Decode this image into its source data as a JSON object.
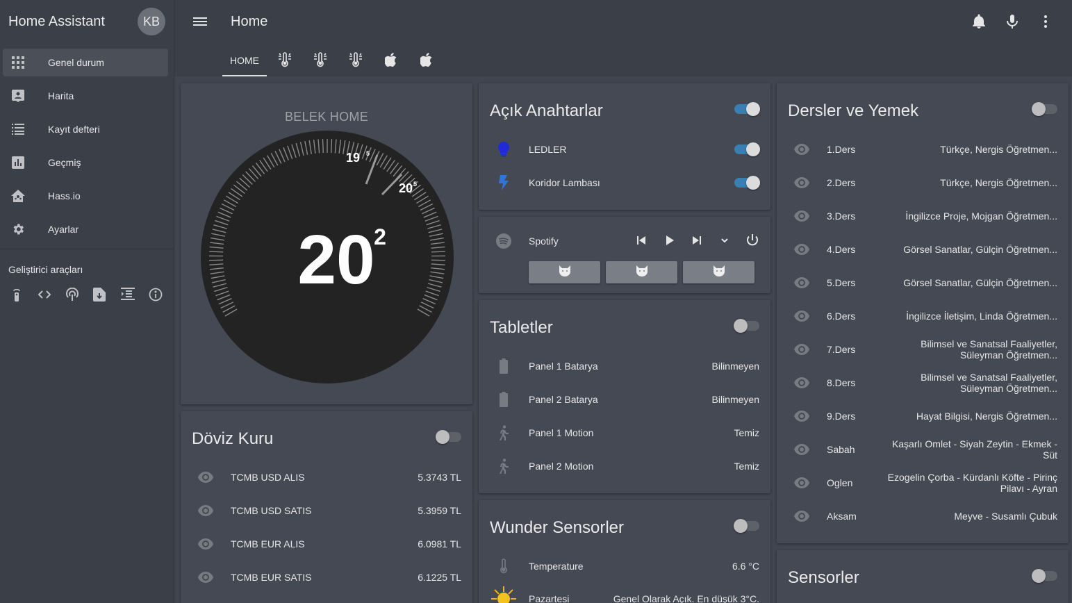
{
  "app": {
    "title": "Home Assistant",
    "avatar_initials": "KB"
  },
  "sidebar": {
    "items": [
      {
        "label": "Genel durum",
        "icon": "grid-icon",
        "active": true
      },
      {
        "label": "Harita",
        "icon": "account-box-icon"
      },
      {
        "label": "Kayıt defteri",
        "icon": "list-icon"
      },
      {
        "label": "Geçmiş",
        "icon": "chart-icon"
      },
      {
        "label": "Hass.io",
        "icon": "home-assistant-icon"
      },
      {
        "label": "Ayarlar",
        "icon": "gear-icon"
      }
    ],
    "dev_tools_title": "Geliştirici araçları",
    "dev_tools": [
      "remote-icon",
      "code-icon",
      "antenna-icon",
      "file-download-icon",
      "template-icon",
      "info-icon"
    ]
  },
  "header": {
    "title": "Home",
    "tabs": [
      {
        "label": "HOME",
        "active": true
      },
      {
        "icon": "thermometer-lines-icon"
      },
      {
        "icon": "thermometer-lines-icon"
      },
      {
        "icon": "thermometer-lines-icon"
      },
      {
        "icon": "apple-icon"
      },
      {
        "icon": "apple-icon"
      }
    ],
    "icons": [
      "bell-icon",
      "microphone-icon",
      "more-vert-icon"
    ]
  },
  "thermostat": {
    "name": "BELEK HOME",
    "current": "20",
    "current_decimal": "2",
    "low": "19",
    "low_decimal": "5",
    "high": "20",
    "high_decimal": "5"
  },
  "doviz": {
    "title": "Döviz Kuru",
    "toggle_on": false,
    "rows": [
      {
        "name": "TCMB USD ALIS",
        "value": "5.3743 TL"
      },
      {
        "name": "TCMB USD SATIS",
        "value": "5.3959 TL"
      },
      {
        "name": "TCMB EUR ALIS",
        "value": "6.0981 TL"
      },
      {
        "name": "TCMB EUR SATIS",
        "value": "6.1225 TL"
      }
    ]
  },
  "anahtarlar": {
    "title": "Açık Anahtarlar",
    "toggle_on": true,
    "rows": [
      {
        "name": "LEDLER",
        "icon": "lightbulb-icon",
        "icon_color": "#1e2bd8",
        "on": true
      },
      {
        "name": "Koridor Lambası",
        "icon": "flash-icon",
        "icon_color": "#2f74d8",
        "on": true
      }
    ]
  },
  "spotify": {
    "name": "Spotify",
    "controls": [
      "skip-previous-icon",
      "play-icon",
      "skip-next-icon",
      "chevron-down-icon",
      "power-icon"
    ],
    "sources": [
      "cat-icon",
      "cat-icon",
      "cat-icon"
    ]
  },
  "tabletler": {
    "title": "Tabletler",
    "toggle_on": false,
    "rows": [
      {
        "name": "Panel 1 Batarya",
        "value": "Bilinmeyen",
        "icon": "battery-icon"
      },
      {
        "name": "Panel 2 Batarya",
        "value": "Bilinmeyen",
        "icon": "battery-icon"
      },
      {
        "name": "Panel 1 Motion",
        "value": "Temiz",
        "icon": "walk-icon"
      },
      {
        "name": "Panel 2 Motion",
        "value": "Temiz",
        "icon": "walk-icon"
      }
    ]
  },
  "wunder": {
    "title": "Wunder Sensorler",
    "toggle_on": false,
    "rows": [
      {
        "name": "Temperature",
        "value": "6.6 °C",
        "icon": "thermometer-icon"
      },
      {
        "name": "Pazartesi",
        "value": "Genel Olarak Açık. En düşük 3°C.",
        "icon": "sun-icon"
      }
    ]
  },
  "dersler": {
    "title": "Dersler ve Yemek",
    "toggle_on": false,
    "rows": [
      {
        "name": "1.Ders",
        "value": "Türkçe, Nergis Öğretmen..."
      },
      {
        "name": "2.Ders",
        "value": "Türkçe, Nergis Öğretmen..."
      },
      {
        "name": "3.Ders",
        "value": "İngilizce Proje, Mojgan Öğretmen..."
      },
      {
        "name": "4.Ders",
        "value": "Görsel Sanatlar, Gülçin Öğretmen..."
      },
      {
        "name": "5.Ders",
        "value": "Görsel Sanatlar, Gülçin Öğretmen..."
      },
      {
        "name": "6.Ders",
        "value": "İngilizce İletişim, Linda Öğretmen..."
      },
      {
        "name": "7.Ders",
        "value": "Bilimsel ve Sanatsal Faaliyetler, Süleyman Öğretmen..."
      },
      {
        "name": "8.Ders",
        "value": "Bilimsel ve Sanatsal Faaliyetler, Süleyman Öğretmen..."
      },
      {
        "name": "9.Ders",
        "value": "Hayat Bilgisi, Nergis Öğretmen..."
      },
      {
        "name": "Sabah",
        "value": "Kaşarlı Omlet - Siyah Zeytin - Ekmek - Süt"
      },
      {
        "name": "Oglen",
        "value": "Ezogelin Çorba - Kürdanlı Köfte - Pirinç Pilavı - Ayran"
      },
      {
        "name": "Aksam",
        "value": "Meyve - Susamlı Çubuk"
      }
    ]
  },
  "sensorler": {
    "title": "Sensorler",
    "toggle_on": false
  }
}
